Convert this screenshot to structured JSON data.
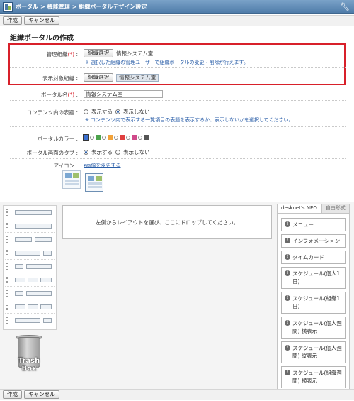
{
  "breadcrumb": {
    "home": "ポータル",
    "sep": ">",
    "level2": "機能管理",
    "level3": "組織ポータルデザイン設定"
  },
  "toolbar": {
    "create": "作成",
    "cancel": "キャンセル"
  },
  "form": {
    "title": "組織ポータルの作成",
    "required_mark": "(*)",
    "colon": ":",
    "admin_org": {
      "label": "管理組織",
      "button": "組織選択",
      "value": "情報システム室",
      "note": "※ 選択した組織の管理ユーザーで組織ポータルの変更・削除が行えます。"
    },
    "target_org": {
      "label": "表示対象組織",
      "button": "組織選択",
      "value": "情報システム室"
    },
    "portal_name": {
      "label": "ポータル名",
      "value": "情報システム室"
    },
    "content_title": {
      "label": "コンテンツ内の表題",
      "opt_show": "表示する",
      "opt_hide": "表示しない",
      "selected": "表示しない",
      "note": "※ コンテンツ内で表示する一覧項目の表題を表示するか、表示しないかを選択してください。"
    },
    "portal_color": {
      "label": "ポータルカラー",
      "colors": [
        "#3a6fd0",
        "#ffffff",
        "#4ca34c",
        "#ffffff",
        "#f2a23a",
        "#ffffff",
        "#e04040",
        "#ffffff",
        "#d04a8a",
        "#ffffff",
        "#555555"
      ],
      "selected_index": 0
    },
    "portal_tab": {
      "label": "ポータル画面のタブ",
      "opt_show": "表示する",
      "opt_hide": "表示しない",
      "selected": "表示する"
    },
    "icon": {
      "label": "アイコン",
      "change_link": "▾画像を変更する"
    }
  },
  "workspace": {
    "drop_hint": "左側からレイアウトを選び、ここにドロップしてください。",
    "trash": "Trash Box",
    "tabs": [
      "desknet's NEO",
      "自由形式"
    ],
    "widgets": [
      "メニュー",
      "インフォメーション",
      "タイムカード",
      "スケジュール(個人1日)",
      "スケジュール(組織1日)",
      "スケジュール(個人週間) 横表示",
      "スケジュール(個人週間) 縦表示",
      "スケジュール(組織週間) 横表示"
    ]
  },
  "colors": {
    "accent": "#4d7aa8",
    "highlight_border": "#d8202a",
    "note": "#2a5ea8"
  }
}
